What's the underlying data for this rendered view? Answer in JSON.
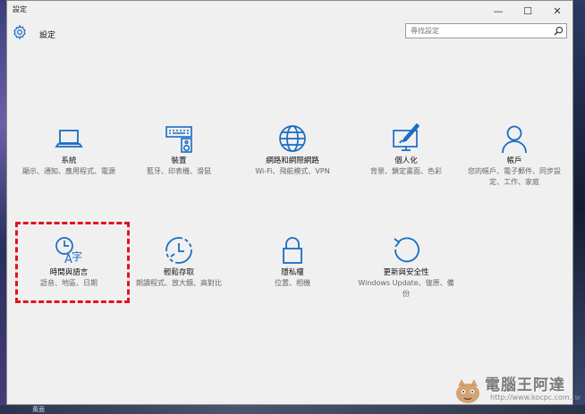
{
  "window": {
    "title": "設定",
    "header_title": "設定",
    "controls": {
      "minimize": "—",
      "maximize": "☐",
      "close": "✕"
    }
  },
  "search": {
    "placeholder": "尋找設定"
  },
  "tiles": [
    {
      "name": "系統",
      "desc": "顯示、通知、應用程式、電源",
      "icon": "laptop-icon"
    },
    {
      "name": "裝置",
      "desc": "藍牙、印表機、滑鼠",
      "icon": "keyboard-speaker-icon"
    },
    {
      "name": "網路和網際網路",
      "desc": "Wi-Fi、飛航模式、VPN",
      "icon": "globe-icon"
    },
    {
      "name": "個人化",
      "desc": "背景、鎖定畫面、色彩",
      "icon": "paint-monitor-icon"
    },
    {
      "name": "帳戶",
      "desc": "您的帳戶、電子郵件、同步設定、工作、家庭",
      "icon": "person-icon"
    },
    {
      "name": "時間與語言",
      "desc": "語音、地區、日期",
      "icon": "clock-language-icon"
    },
    {
      "name": "輕鬆存取",
      "desc": "朗讀程式、放大鏡、高對比",
      "icon": "ease-of-access-icon"
    },
    {
      "name": "隱私權",
      "desc": "位置、相機",
      "icon": "lock-icon"
    },
    {
      "name": "更新與安全性",
      "desc": "Windows Update、復原、備份",
      "icon": "update-icon"
    }
  ],
  "watermark": {
    "title": "電腦王阿達",
    "url": "http://www.kocpc.com.tw"
  },
  "taskbar": {
    "fragment": "黃面"
  },
  "colors": {
    "accent": "#1a6cc4",
    "highlight": "#e0141e"
  }
}
